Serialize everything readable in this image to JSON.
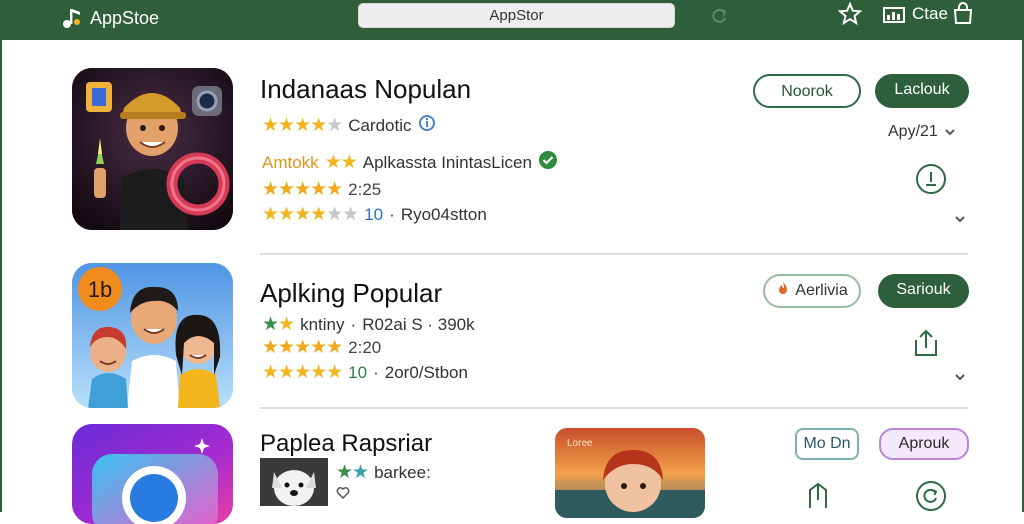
{
  "topbar": {
    "brand": "AppStoe",
    "search_value": "AppStor",
    "cart_label": "Ctae"
  },
  "apps": [
    {
      "title": "Indanaas Nopulan",
      "rating_label": "Cardotic",
      "line2_prefix": "Amtokk",
      "line2_text": "Aplkassta InintasLicen",
      "line3_value": "2:25",
      "line4_value": "10",
      "line4_text": "Ryo04stton",
      "button_outline": "Noorok",
      "button_solid": "Laclouk",
      "aside_text": "Apy/21"
    },
    {
      "title": "Aplking Popular",
      "badge": "1b",
      "line2_prefix": "kntiny",
      "line2_text": "R02ai S · 390k",
      "line3_value": "2:20",
      "line4_value": "10",
      "line4_text": "2or0/Stbon",
      "button_outline": "Aerlivia",
      "button_solid": "Sariouk"
    },
    {
      "title": "Paplea Rapsriar",
      "line2_text": "barkee:",
      "button_outline": "Mo Dn",
      "button_solid": "Aprouk",
      "preview_text": "Loree"
    }
  ],
  "colors": {
    "brand_green": "#2f5f3a",
    "star_gold": "#f2b51f",
    "check_green": "#2e8b3e"
  }
}
